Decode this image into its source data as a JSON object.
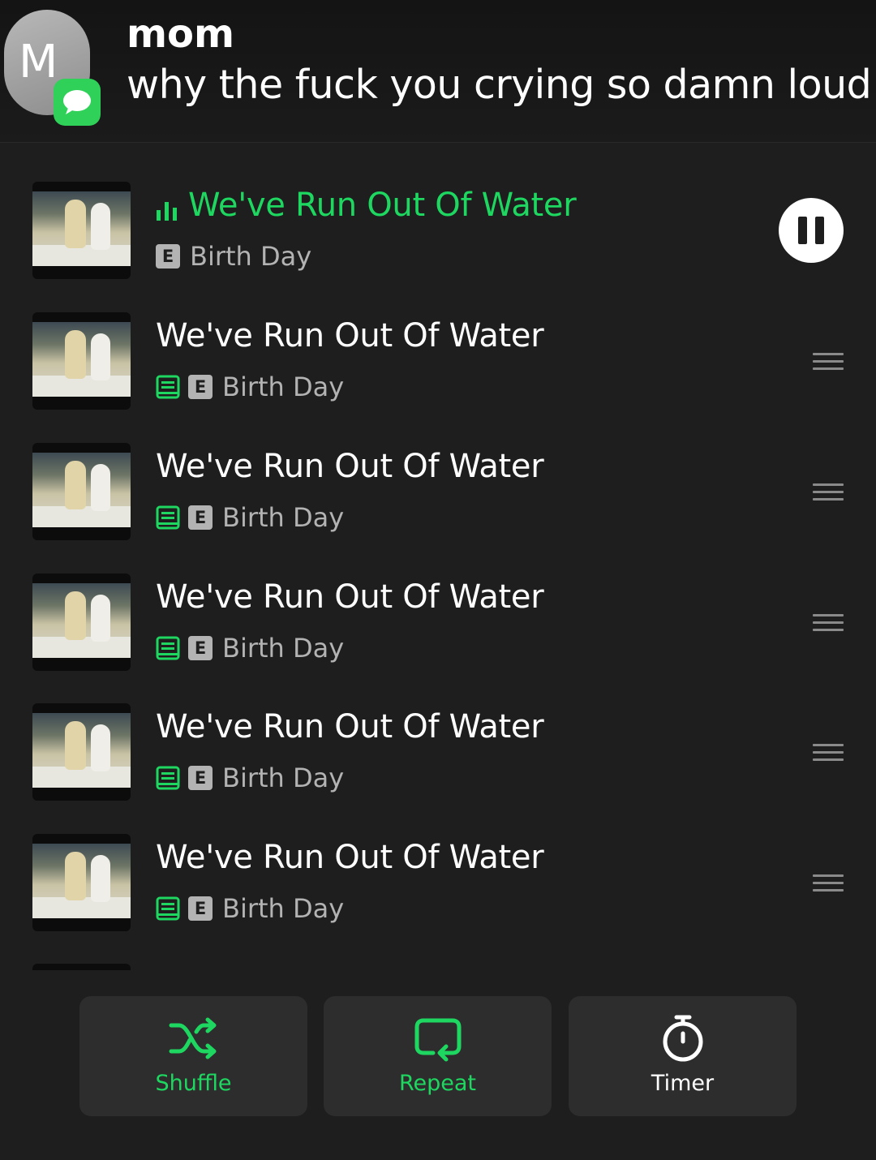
{
  "notification": {
    "avatar_initial": "M",
    "sender": "mom",
    "message": "why the fuck you crying so damn loud",
    "badge_icon": "messages-icon",
    "badge_color": "#2fd158"
  },
  "colors": {
    "accent": "#1ed760",
    "background": "#1e1e1e",
    "button_bg": "#2d2d2d"
  },
  "queue": {
    "now_playing": {
      "title": "We've Run Out Of Water",
      "artist": "Birth Day",
      "explicit": "E",
      "playing_icon": "equalizer-icon",
      "control_icon": "pause-icon"
    },
    "tracks": [
      {
        "title": "We've Run Out Of Water",
        "artist": "Birth Day",
        "explicit": "E"
      },
      {
        "title": "We've Run Out Of Water",
        "artist": "Birth Day",
        "explicit": "E"
      },
      {
        "title": "We've Run Out Of Water",
        "artist": "Birth Day",
        "explicit": "E"
      },
      {
        "title": "We've Run Out Of Water",
        "artist": "Birth Day",
        "explicit": "E"
      },
      {
        "title": "We've Run Out Of Water",
        "artist": "Birth Day",
        "explicit": "E"
      }
    ]
  },
  "controls": {
    "shuffle": {
      "label": "Shuffle",
      "active": true,
      "icon": "shuffle-icon"
    },
    "repeat": {
      "label": "Repeat",
      "active": true,
      "icon": "repeat-icon"
    },
    "timer": {
      "label": "Timer",
      "active": false,
      "icon": "timer-icon"
    }
  }
}
